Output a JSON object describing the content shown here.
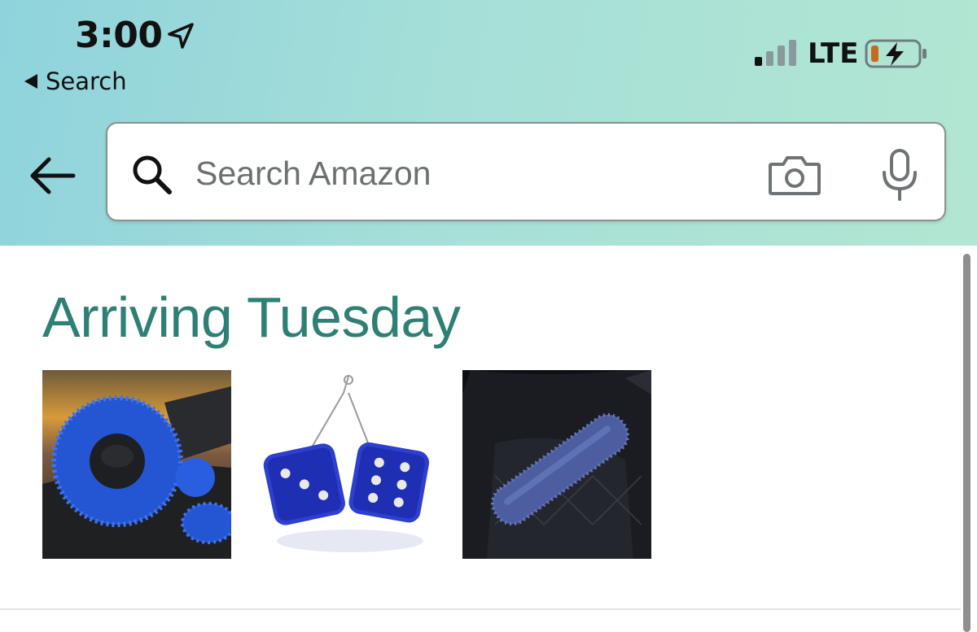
{
  "status_bar": {
    "time": "3:00",
    "back_app_label": "Search",
    "network": "LTE",
    "icons": [
      "location-arrow-icon",
      "signal-bars-icon",
      "battery-charging-icon"
    ]
  },
  "search": {
    "placeholder": "Search Amazon",
    "value": "",
    "icons": [
      "back-arrow-icon",
      "search-icon",
      "camera-icon",
      "microphone-icon"
    ]
  },
  "delivery": {
    "title": "Arriving Tuesday",
    "items": [
      {
        "image": "blue fuzzy steering wheel cover"
      },
      {
        "image": "blue fuzzy dice"
      },
      {
        "image": "blue fuzzy seat belt cover"
      }
    ]
  },
  "colors": {
    "header_gradient_start": "#8fd3dc",
    "header_gradient_end": "#b2e6d2",
    "title_color": "#2e7f74"
  }
}
